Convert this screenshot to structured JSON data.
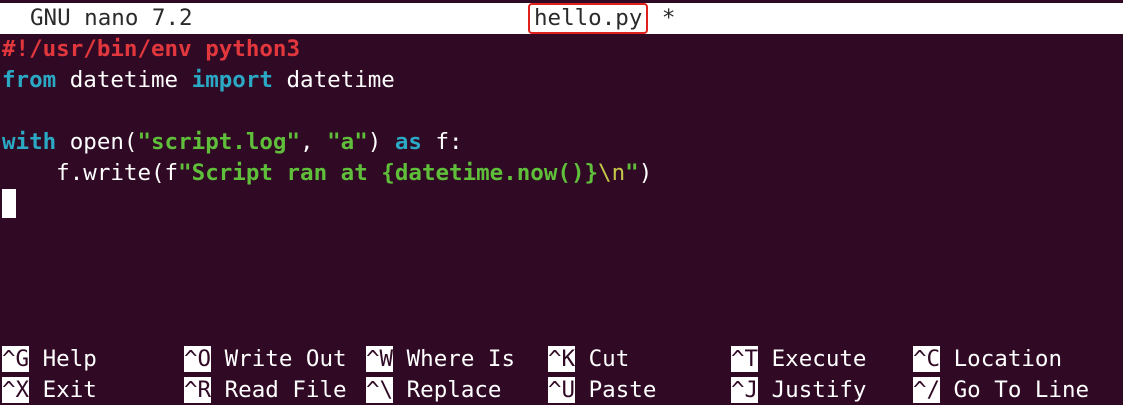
{
  "titlebar": {
    "app": "GNU nano 7.2",
    "filename": "hello.py",
    "modified_marker": "*"
  },
  "editor": {
    "lines": [
      {
        "shebang": "#!/usr/bin/env python3"
      },
      {
        "kw1": "from",
        "t1": " datetime ",
        "kw2": "import",
        "t2": " datetime"
      },
      {},
      {
        "kw1": "with",
        "t1": " open(",
        "s1": "\"script.log\"",
        "t2": ", ",
        "s2": "\"a\"",
        "t3": ") ",
        "kw2": "as",
        "t4": " f:"
      },
      {
        "t1": "    f.write(f",
        "s1": "\"Script ran at {datetime.now()}",
        "esc": "\\n",
        "s2": "\"",
        "t2": ")"
      }
    ]
  },
  "shortcuts": [
    [
      {
        "key": "^G",
        "label": "Help"
      },
      {
        "key": "^O",
        "label": "Write Out"
      },
      {
        "key": "^W",
        "label": "Where Is"
      },
      {
        "key": "^K",
        "label": "Cut"
      },
      {
        "key": "^T",
        "label": "Execute"
      },
      {
        "key": "^C",
        "label": "Location"
      }
    ],
    [
      {
        "key": "^X",
        "label": "Exit"
      },
      {
        "key": "^R",
        "label": "Read File"
      },
      {
        "key": "^\\",
        "label": "Replace"
      },
      {
        "key": "^U",
        "label": "Paste"
      },
      {
        "key": "^J",
        "label": "Justify"
      },
      {
        "key": "^/",
        "label": "Go To Line"
      }
    ]
  ],
  "colors": {
    "background": "#300a24",
    "keyword": "#2aa8c4",
    "string": "#5fbf3a",
    "shebang": "#e2373c",
    "escape": "#c4c84a",
    "highlight_box": "#e0201a"
  }
}
